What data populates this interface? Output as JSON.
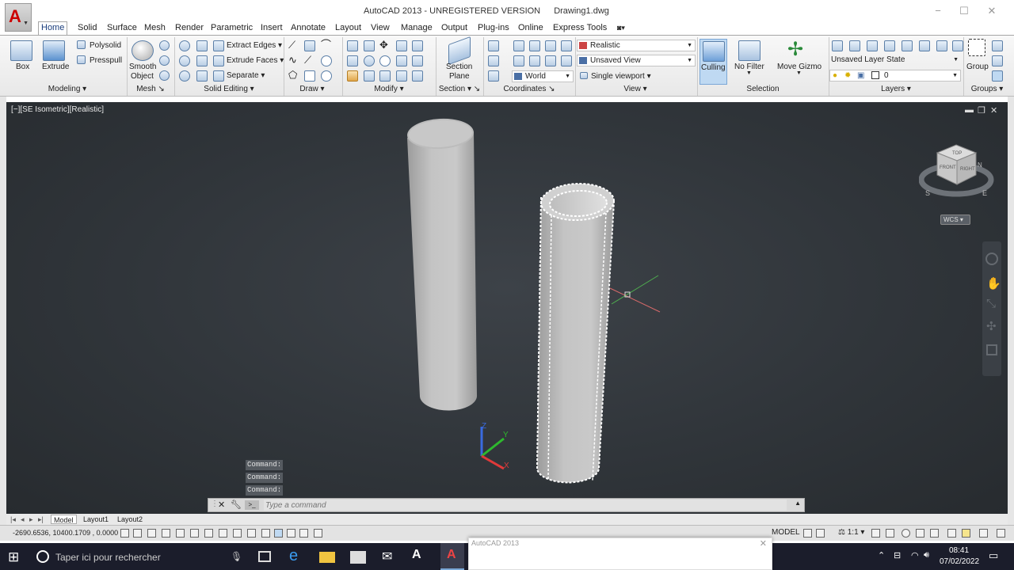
{
  "title_bar": {
    "app_title": "AutoCAD 2013 - UNREGISTERED VERSION",
    "document": "Drawing1.dwg"
  },
  "ribbon_tabs": [
    "Home",
    "Solid",
    "Surface",
    "Mesh",
    "Render",
    "Parametric",
    "Insert",
    "Annotate",
    "Layout",
    "View",
    "Manage",
    "Output",
    "Plug-ins",
    "Online",
    "Express Tools"
  ],
  "active_tab": "Home",
  "ribbon": {
    "modeling": {
      "box": "Box",
      "extrude": "Extrude",
      "polysolid": "Polysolid",
      "presspull": "Presspull",
      "title": "Modeling"
    },
    "mesh": {
      "smooth_object_line1": "Smooth",
      "smooth_object_line2": "Object",
      "title": "Mesh"
    },
    "solid_editing": {
      "extract_edges": "Extract Edges",
      "extrude_faces": "Extrude Faces",
      "separate": "Separate",
      "title": "Solid Editing"
    },
    "draw": {
      "title": "Draw"
    },
    "modify": {
      "title": "Modify"
    },
    "section": {
      "section_plane_line1": "Section",
      "section_plane_line2": "Plane",
      "title": "Section"
    },
    "coordinates": {
      "world": "World",
      "title": "Coordinates"
    },
    "view": {
      "visual_style": "Realistic",
      "saved_view": "Unsaved View",
      "viewport": "Single viewport",
      "title": "View"
    },
    "selection": {
      "culling": "Culling",
      "no_filter": "No Filter",
      "move_gizmo": "Move Gizmo",
      "title": "Selection"
    },
    "layers": {
      "layer_state": "Unsaved Layer State",
      "current_layer": "0",
      "title": "Layers"
    },
    "groups": {
      "group": "Group",
      "title": "Groups"
    }
  },
  "viewport": {
    "label": "[−][SE Isometric][Realistic]",
    "wcs": "WCS",
    "viewcube_faces": {
      "top": "TOP",
      "front": "FRONT",
      "right": "RIGHT"
    },
    "compass": {
      "s": "S",
      "e": "E",
      "n": "N"
    },
    "ucs_labels": {
      "x": "X",
      "y": "Y",
      "z": "Z"
    }
  },
  "command_history": [
    "Command:",
    "Command:",
    "Command:"
  ],
  "command_placeholder": "Type a command",
  "layout_tabs": [
    "Model",
    "Layout1",
    "Layout2"
  ],
  "status": {
    "coordinates": "-2690.6536, 10400.1709 , 0.0000",
    "model": "MODEL",
    "scale": "1:1"
  },
  "taskbar": {
    "search_placeholder": "Taper ici pour rechercher",
    "time": "08:41",
    "date": "07/02/2022",
    "popup_title": "AutoCAD 2013"
  },
  "colors": {
    "ribbon_bg": "#f0f0f0",
    "canvas_bg": "#2e3338",
    "taskbar_bg": "#1b1d2b",
    "accent": "#1a3d7c"
  }
}
